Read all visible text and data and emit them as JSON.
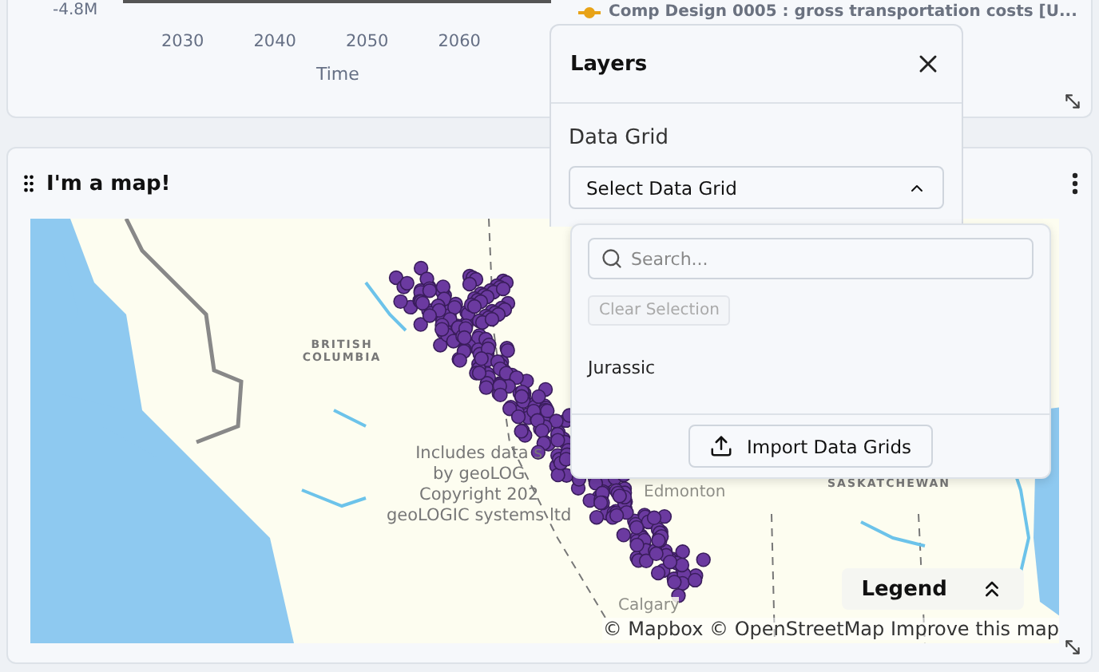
{
  "chart_panel": {
    "y_tick_label": "-4.8M",
    "x_tick_labels": [
      "2030",
      "2040",
      "2050",
      "2060"
    ],
    "x_axis_title": "Time",
    "legend_entry": "Comp Design 0005 : gross transportation costs [U..."
  },
  "map_panel": {
    "title": "I'm a map!",
    "map_labels": [
      {
        "text": "BRITISH COLUMBIA",
        "kind": "region"
      },
      {
        "text": "Edmonton",
        "kind": "city"
      },
      {
        "text": "SASKATCHEWAN",
        "kind": "region"
      },
      {
        "text": "Calgary",
        "kind": "city"
      }
    ],
    "data_notice": [
      "Includes data s",
      "by geoLOG",
      "Copyright 202",
      "geoLOGIC systems ltd"
    ],
    "legend": {
      "label": "Legend",
      "expanded": false
    },
    "attribution": "© Mapbox © OpenStreetMap Improve this map"
  },
  "layers_popup": {
    "title": "Layers",
    "section": "Data Grid",
    "select": {
      "value": "Select Data Grid",
      "expanded": true
    },
    "dropdown": {
      "search_placeholder": "Search...",
      "clear_button": {
        "label": "Clear Selection",
        "disabled": true
      },
      "options": [
        {
          "label": "Jurassic",
          "selected": false
        }
      ],
      "import_button": "Import Data Grids"
    }
  }
}
